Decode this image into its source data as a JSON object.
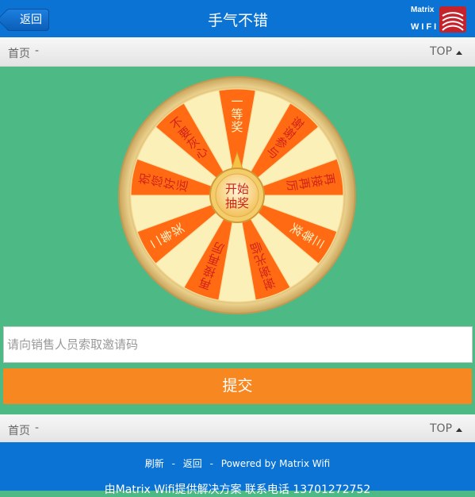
{
  "header": {
    "back_label": "返回",
    "title": "手气不错",
    "logo_top": "Matrix",
    "logo_bottom": "WIFI"
  },
  "breadcrumb": {
    "home": "首页",
    "separator": "-",
    "top": "TOP"
  },
  "wheel": {
    "center_line1": "开始",
    "center_line2": "抽奖",
    "prizes": [
      "一等奖",
      "谢谢参与",
      "再接再厉",
      "三等奖",
      "谢谢光临",
      "再接再厉",
      "二等奖",
      "祝您好运",
      "不要灰心"
    ],
    "colors": {
      "orange": "#ff6a12",
      "cream": "#fbf0b8",
      "rim": "#e9cf8c",
      "red_text": "#d0231b"
    }
  },
  "form": {
    "placeholder": "请向销售人员索取邀请码",
    "submit_label": "提交"
  },
  "footer": {
    "refresh": "刷新",
    "separator": "-",
    "back": "返回",
    "powered": "Powered by Matrix Wifi",
    "copyright": "由Matrix Wifi提供解决方案 联系电话 13701272752"
  },
  "colors": {
    "header_blue": "#0a73d4",
    "bg_green": "#4dba86",
    "submit_orange": "#f78720"
  }
}
